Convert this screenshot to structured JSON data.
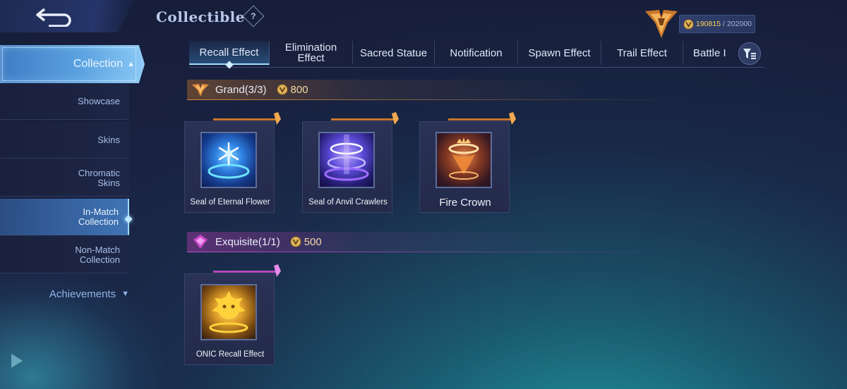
{
  "header": {
    "title": "Collectible",
    "help_glyph": "?",
    "points_current": "190815",
    "points_sep": "/",
    "points_max": "202000"
  },
  "sidebar": {
    "collection_label": "Collection",
    "sub_items": [
      {
        "label_line1": "Showcase",
        "label_line2": ""
      },
      {
        "label_line1": "Skins",
        "label_line2": ""
      },
      {
        "label_line1": "Chromatic",
        "label_line2": "Skins"
      },
      {
        "label_line1": "In-Match",
        "label_line2": "Collection"
      },
      {
        "label_line1": "Non-Match",
        "label_line2": "Collection"
      }
    ],
    "achievements_label": "Achievements"
  },
  "tabs": [
    {
      "line1": "Recall Effect",
      "line2": ""
    },
    {
      "line1": "Elimination",
      "line2": "Effect"
    },
    {
      "line1": "Sacred Statue",
      "line2": ""
    },
    {
      "line1": "Notification",
      "line2": ""
    },
    {
      "line1": "Spawn Effect",
      "line2": ""
    },
    {
      "line1": "Trail Effect",
      "line2": ""
    },
    {
      "line1": "Battle I",
      "line2": ""
    }
  ],
  "sections": {
    "grand": {
      "label": "Grand(3/3)",
      "price": "800",
      "accent": "#d78b3b",
      "items": [
        {
          "name": "Seal of Eternal Flower",
          "icon": "snowflake-seal-icon"
        },
        {
          "name": "Seal of Anvil Crawlers",
          "icon": "purple-rings-icon"
        },
        {
          "name": "Fire Crown",
          "icon": "fire-crown-icon"
        }
      ]
    },
    "exquisite": {
      "label": "Exquisite(1/1)",
      "price": "500",
      "accent": "#c050c8",
      "items": [
        {
          "name": "ONIC Recall Effect",
          "icon": "golden-lion-icon"
        }
      ]
    }
  },
  "colors": {
    "gold": "#ffd15c",
    "active_blue": "#9fdcff"
  }
}
